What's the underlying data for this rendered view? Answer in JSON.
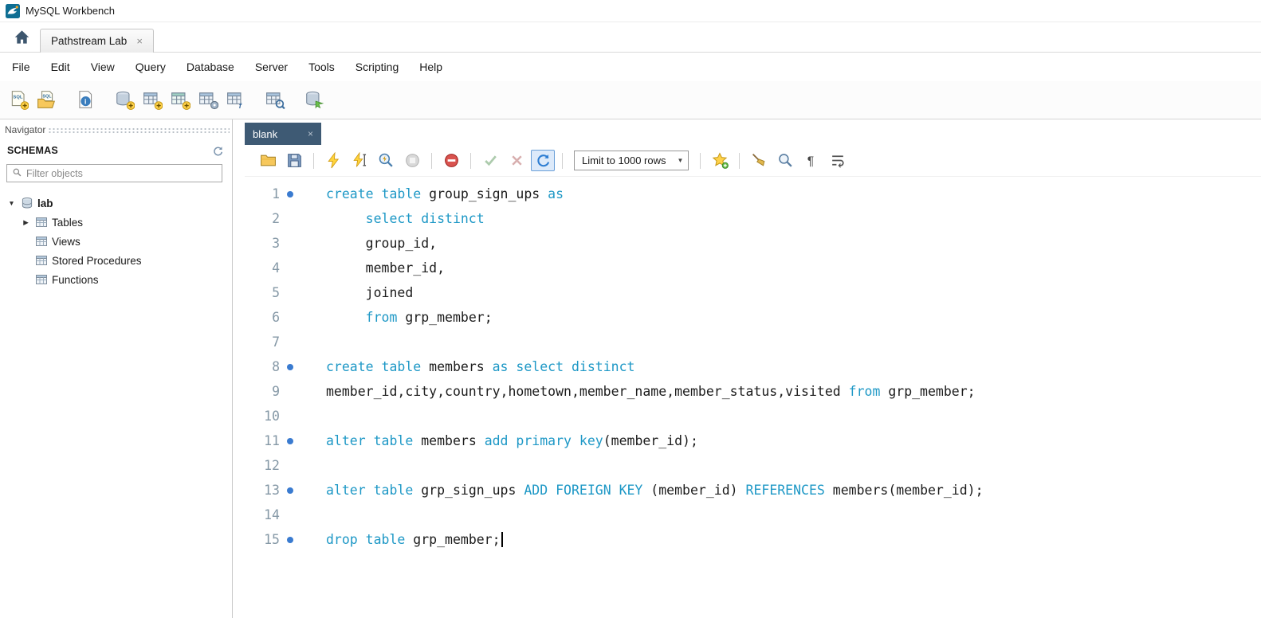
{
  "window": {
    "title": "MySQL Workbench"
  },
  "home": {
    "tab_label": "Pathstream Lab",
    "close_glyph": "×"
  },
  "menu": {
    "items": [
      "File",
      "Edit",
      "View",
      "Query",
      "Database",
      "Server",
      "Tools",
      "Scripting",
      "Help"
    ]
  },
  "main_toolbar": {
    "groups": [
      [
        "new-sql-tab",
        "open-sql-script"
      ],
      [
        "inspector"
      ],
      [
        "create-schema",
        "create-table",
        "create-view",
        "create-procedure",
        "create-function"
      ],
      [
        "search-table-data"
      ],
      [
        "reconnect-database"
      ]
    ]
  },
  "navigator": {
    "label": "Navigator",
    "schemas_header": "SCHEMAS",
    "filter_placeholder": "Filter objects",
    "tree": [
      {
        "label": "lab",
        "indent": 0,
        "arrow": "down",
        "icon": "schema",
        "bold": true
      },
      {
        "label": "Tables",
        "indent": 1,
        "arrow": "right",
        "icon": "table-group",
        "bold": false
      },
      {
        "label": "Views",
        "indent": 1,
        "arrow": "none",
        "icon": "table-group",
        "bold": false
      },
      {
        "label": "Stored Procedures",
        "indent": 1,
        "arrow": "none",
        "icon": "table-group",
        "bold": false
      },
      {
        "label": "Functions",
        "indent": 1,
        "arrow": "none",
        "icon": "table-group",
        "bold": false
      }
    ]
  },
  "editor": {
    "tab_label": "blank",
    "tab_close": "×",
    "toolbar_items": [
      {
        "type": "icon",
        "name": "open-script"
      },
      {
        "type": "icon",
        "name": "save-script"
      },
      {
        "type": "sep"
      },
      {
        "type": "icon",
        "name": "execute"
      },
      {
        "type": "icon",
        "name": "execute-current"
      },
      {
        "type": "icon",
        "name": "explain"
      },
      {
        "type": "icon",
        "name": "stop",
        "disabled": true
      },
      {
        "type": "sep"
      },
      {
        "type": "icon",
        "name": "stop-on-error"
      },
      {
        "type": "sep"
      },
      {
        "type": "icon",
        "name": "commit",
        "disabled": true
      },
      {
        "type": "icon",
        "name": "rollback",
        "disabled": true
      },
      {
        "type": "icon",
        "name": "autocommit",
        "active": true
      },
      {
        "type": "sep"
      },
      {
        "type": "dropdown",
        "name": "limit-rows",
        "label": "Limit to 1000 rows",
        "caret": "▼"
      },
      {
        "type": "sep"
      },
      {
        "type": "icon",
        "name": "save-snippet"
      },
      {
        "type": "sep"
      },
      {
        "type": "icon",
        "name": "beautify"
      },
      {
        "type": "icon",
        "name": "find"
      },
      {
        "type": "icon",
        "name": "invisibles"
      },
      {
        "type": "icon",
        "name": "wrap-text"
      }
    ],
    "lines": [
      {
        "n": "1",
        "marker": true,
        "code": [
          [
            "k",
            "create table"
          ],
          [
            "p",
            " group_sign_ups "
          ],
          [
            "k",
            "as"
          ]
        ]
      },
      {
        "n": "2",
        "marker": false,
        "code": [
          [
            "p",
            "     "
          ],
          [
            "k",
            "select distinct"
          ]
        ]
      },
      {
        "n": "3",
        "marker": false,
        "code": [
          [
            "p",
            "     group_id,"
          ]
        ]
      },
      {
        "n": "4",
        "marker": false,
        "code": [
          [
            "p",
            "     member_id,"
          ]
        ]
      },
      {
        "n": "5",
        "marker": false,
        "code": [
          [
            "p",
            "     joined"
          ]
        ]
      },
      {
        "n": "6",
        "marker": false,
        "code": [
          [
            "p",
            "     "
          ],
          [
            "k",
            "from"
          ],
          [
            "p",
            " grp_member;"
          ]
        ]
      },
      {
        "n": "7",
        "marker": false,
        "code": []
      },
      {
        "n": "8",
        "marker": true,
        "code": [
          [
            "k",
            "create table"
          ],
          [
            "p",
            " members "
          ],
          [
            "k",
            "as select distinct"
          ]
        ]
      },
      {
        "n": "9",
        "marker": false,
        "code": [
          [
            "p",
            "member_id,city,country,hometown,member_name,member_status,visited "
          ],
          [
            "k",
            "from"
          ],
          [
            "p",
            " grp_member;"
          ]
        ]
      },
      {
        "n": "10",
        "marker": false,
        "code": []
      },
      {
        "n": "11",
        "marker": true,
        "code": [
          [
            "k",
            "alter table"
          ],
          [
            "p",
            " members "
          ],
          [
            "k",
            "add primary key"
          ],
          [
            "p",
            "(member_id);"
          ]
        ]
      },
      {
        "n": "12",
        "marker": false,
        "code": []
      },
      {
        "n": "13",
        "marker": true,
        "code": [
          [
            "k",
            "alter table"
          ],
          [
            "p",
            " grp_sign_ups "
          ],
          [
            "k",
            "ADD FOREIGN KEY"
          ],
          [
            "p",
            " (member_id) "
          ],
          [
            "k",
            "REFERENCES"
          ],
          [
            "p",
            " members(member_id);"
          ]
        ]
      },
      {
        "n": "14",
        "marker": false,
        "code": []
      },
      {
        "n": "15",
        "marker": true,
        "caret": true,
        "code": [
          [
            "k",
            "drop table"
          ],
          [
            "p",
            " grp_member;"
          ]
        ]
      }
    ]
  },
  "colors": {
    "keyword": "#1e98c6",
    "statement_marker": "#3a7bd0",
    "editor_tab_bg": "#3e5a74"
  }
}
